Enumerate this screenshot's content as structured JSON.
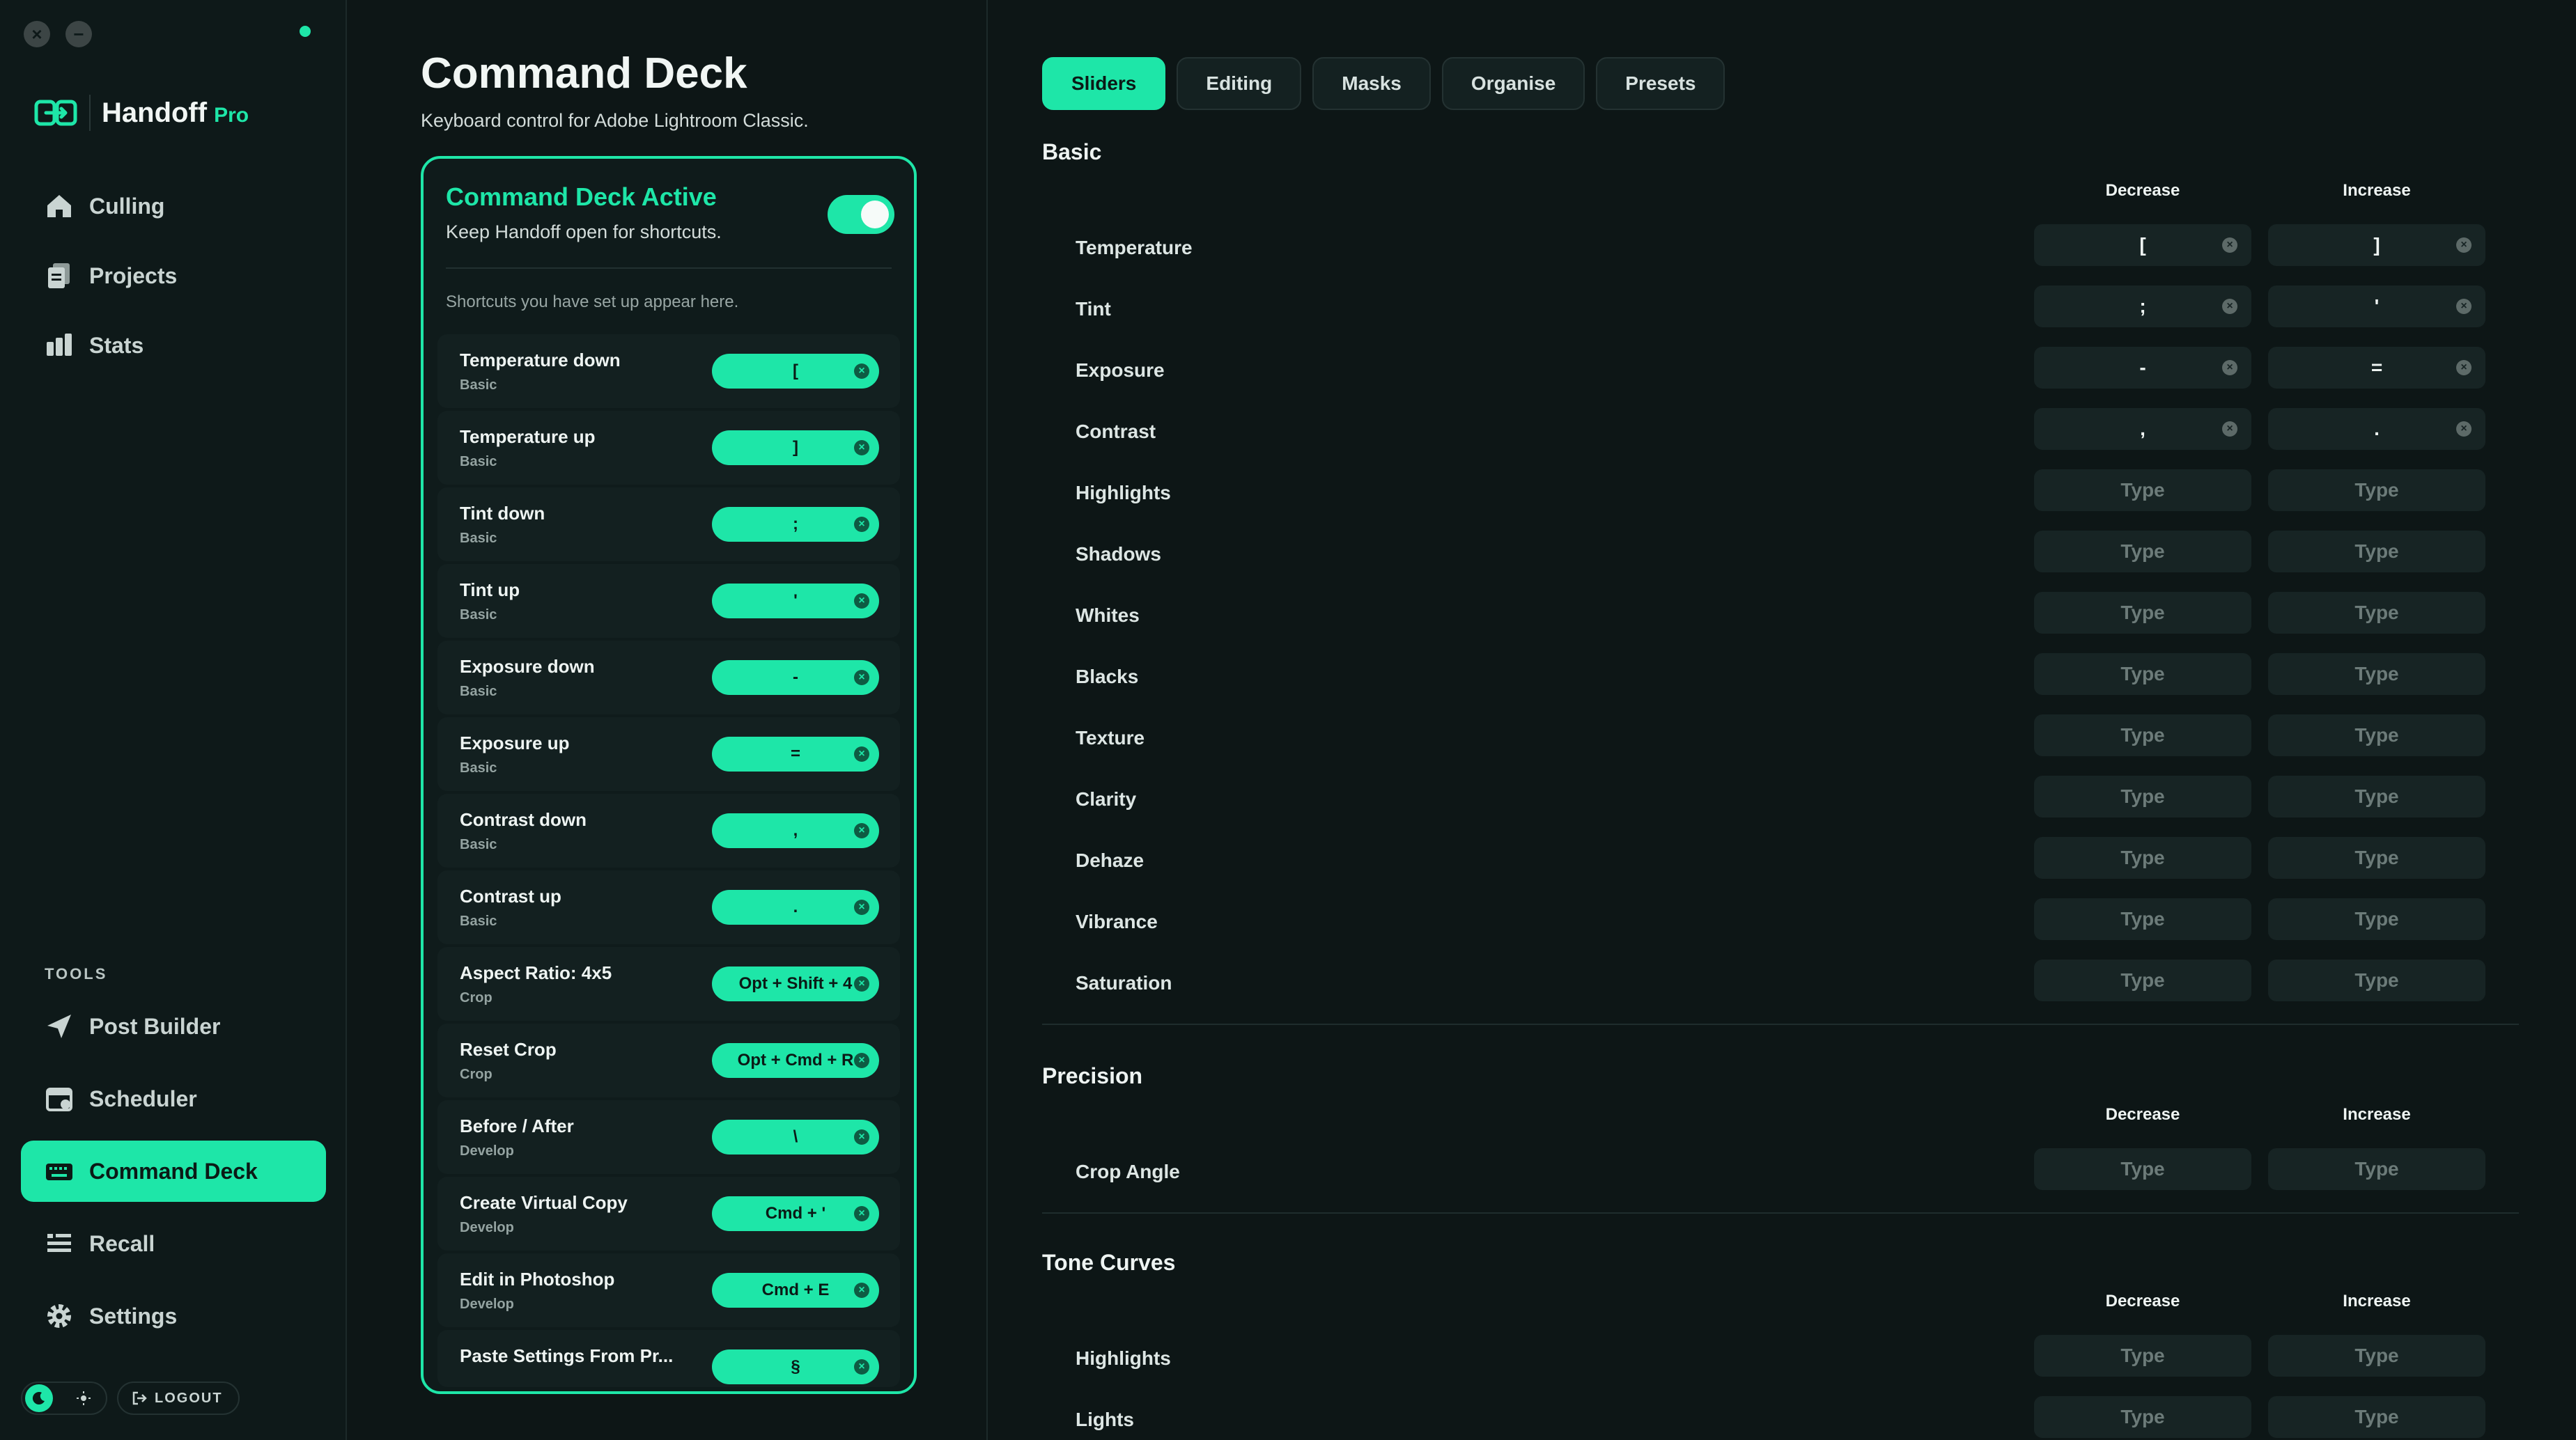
{
  "window": {
    "close_glyph": "×",
    "minimize_glyph": "−"
  },
  "brand": {
    "name": "Handoff",
    "tier": "Pro"
  },
  "nav": {
    "items": [
      {
        "label": "Culling",
        "icon": "home-icon"
      },
      {
        "label": "Projects",
        "icon": "documents-icon"
      },
      {
        "label": "Stats",
        "icon": "bar-chart-icon"
      }
    ],
    "tools_heading": "TOOLS",
    "tools": [
      {
        "label": "Post Builder",
        "icon": "paper-plane-icon"
      },
      {
        "label": "Scheduler",
        "icon": "calendar-icon"
      },
      {
        "label": "Command Deck",
        "icon": "keyboard-icon",
        "active": true
      },
      {
        "label": "Recall",
        "icon": "list-icon"
      },
      {
        "label": "Settings",
        "icon": "gear-icon"
      }
    ],
    "logout_label": "LOGOUT"
  },
  "page": {
    "title": "Command Deck",
    "subtitle": "Keyboard control for Adobe Lightroom Classic."
  },
  "deck": {
    "title": "Command Deck Active",
    "subtitle": "Keep Handoff open for shortcuts.",
    "enabled": true,
    "hint": "Shortcuts you have set up appear here.",
    "shortcuts": [
      {
        "name": "Temperature down",
        "category": "Basic",
        "key": "["
      },
      {
        "name": "Temperature up",
        "category": "Basic",
        "key": "]"
      },
      {
        "name": "Tint down",
        "category": "Basic",
        "key": ";"
      },
      {
        "name": "Tint up",
        "category": "Basic",
        "key": "'"
      },
      {
        "name": "Exposure down",
        "category": "Basic",
        "key": "-"
      },
      {
        "name": "Exposure up",
        "category": "Basic",
        "key": "="
      },
      {
        "name": "Contrast down",
        "category": "Basic",
        "key": ","
      },
      {
        "name": "Contrast up",
        "category": "Basic",
        "key": "."
      },
      {
        "name": "Aspect Ratio: 4x5",
        "category": "Crop",
        "key": "Opt + Shift + 4"
      },
      {
        "name": "Reset Crop",
        "category": "Crop",
        "key": "Opt + Cmd + R"
      },
      {
        "name": "Before / After",
        "category": "Develop",
        "key": "\\"
      },
      {
        "name": "Create Virtual Copy",
        "category": "Develop",
        "key": "Cmd + '"
      },
      {
        "name": "Edit in Photoshop",
        "category": "Develop",
        "key": "Cmd + E"
      },
      {
        "name": "Paste Settings From Pr...",
        "category": "",
        "key": "§"
      }
    ]
  },
  "tabs": [
    {
      "label": "Sliders",
      "active": true
    },
    {
      "label": "Editing"
    },
    {
      "label": "Masks"
    },
    {
      "label": "Organise"
    },
    {
      "label": "Presets"
    }
  ],
  "sections": [
    {
      "title": "Basic",
      "decrease_label": "Decrease",
      "increase_label": "Increase",
      "rows": [
        {
          "label": "Temperature",
          "decrease": "[",
          "increase": "]"
        },
        {
          "label": "Tint",
          "decrease": ";",
          "increase": "'"
        },
        {
          "label": "Exposure",
          "decrease": "-",
          "increase": "="
        },
        {
          "label": "Contrast",
          "decrease": ",",
          "increase": "."
        },
        {
          "label": "Highlights",
          "decrease": "",
          "increase": ""
        },
        {
          "label": "Shadows",
          "decrease": "",
          "increase": ""
        },
        {
          "label": "Whites",
          "decrease": "",
          "increase": ""
        },
        {
          "label": "Blacks",
          "decrease": "",
          "increase": ""
        },
        {
          "label": "Texture",
          "decrease": "",
          "increase": ""
        },
        {
          "label": "Clarity",
          "decrease": "",
          "increase": ""
        },
        {
          "label": "Dehaze",
          "decrease": "",
          "increase": ""
        },
        {
          "label": "Vibrance",
          "decrease": "",
          "increase": ""
        },
        {
          "label": "Saturation",
          "decrease": "",
          "increase": ""
        }
      ]
    },
    {
      "title": "Precision",
      "decrease_label": "Decrease",
      "increase_label": "Increase",
      "rows": [
        {
          "label": "Crop Angle",
          "decrease": "",
          "increase": ""
        }
      ]
    },
    {
      "title": "Tone Curves",
      "decrease_label": "Decrease",
      "increase_label": "Increase",
      "rows": [
        {
          "label": "Highlights",
          "decrease": "",
          "increase": ""
        },
        {
          "label": "Lights",
          "decrease": "",
          "increase": ""
        }
      ]
    }
  ],
  "empty_key_placeholder": "Type",
  "colors": {
    "accent": "#1ee6a8",
    "background": "#0d1616",
    "sidebar": "#0e1919",
    "field": "#172424"
  }
}
